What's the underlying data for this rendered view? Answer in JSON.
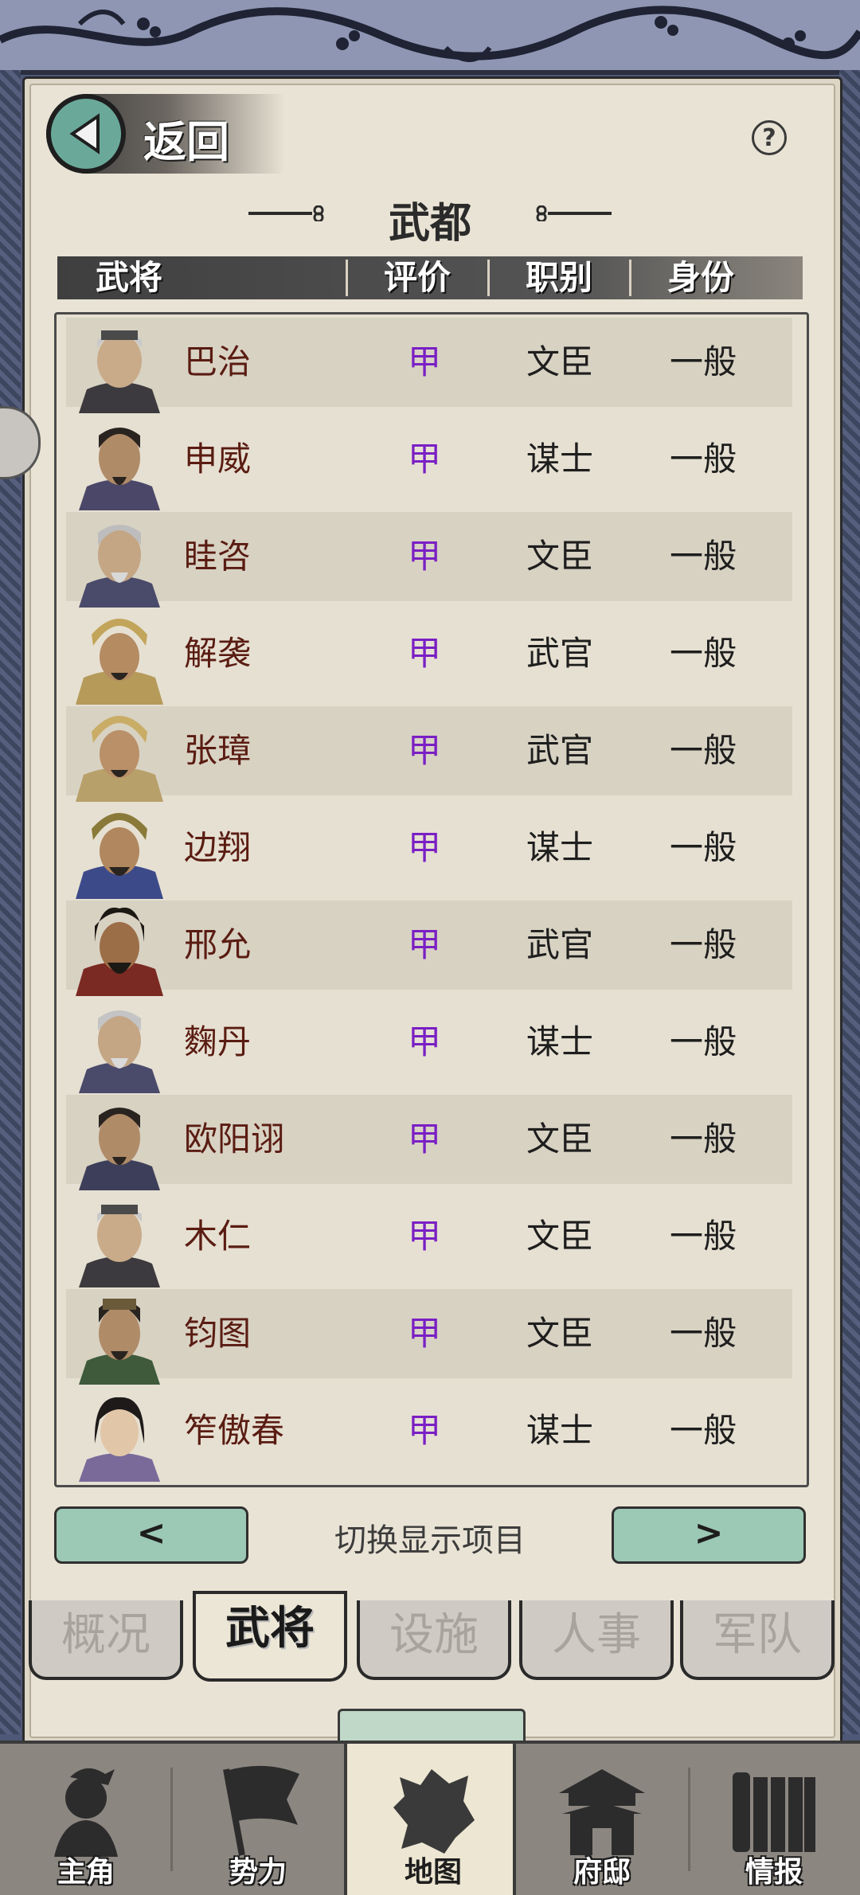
{
  "header": {
    "back_label": "返回",
    "help_symbol": "?",
    "city_name": "武都"
  },
  "columns": {
    "general": "武将",
    "rating": "评价",
    "post": "职别",
    "status": "身份"
  },
  "generals": [
    {
      "name": "巴治",
      "rating": "甲",
      "post": "文臣",
      "status": "一般"
    },
    {
      "name": "申威",
      "rating": "甲",
      "post": "谋士",
      "status": "一般"
    },
    {
      "name": "眭咨",
      "rating": "甲",
      "post": "文臣",
      "status": "一般"
    },
    {
      "name": "解袭",
      "rating": "甲",
      "post": "武官",
      "status": "一般"
    },
    {
      "name": "张璋",
      "rating": "甲",
      "post": "武官",
      "status": "一般"
    },
    {
      "name": "边翔",
      "rating": "甲",
      "post": "谋士",
      "status": "一般"
    },
    {
      "name": "邢允",
      "rating": "甲",
      "post": "武官",
      "status": "一般"
    },
    {
      "name": "麴丹",
      "rating": "甲",
      "post": "谋士",
      "status": "一般"
    },
    {
      "name": "欧阳诩",
      "rating": "甲",
      "post": "文臣",
      "status": "一般"
    },
    {
      "name": "木仁",
      "rating": "甲",
      "post": "文臣",
      "status": "一般"
    },
    {
      "name": "钧图",
      "rating": "甲",
      "post": "文臣",
      "status": "一般"
    },
    {
      "name": "笮傲春",
      "rating": "甲",
      "post": "谋士",
      "status": "一般"
    }
  ],
  "pager": {
    "prev": "<",
    "next": ">",
    "label": "切换显示项目"
  },
  "tabs": [
    "概况",
    "武将",
    "设施",
    "人事",
    "军队"
  ],
  "active_tab": "武将",
  "bottom_nav": [
    "主角",
    "势力",
    "地图",
    "府邸",
    "情报"
  ],
  "active_nav": "地图",
  "colors": {
    "rating": "#7a1fc4",
    "name": "#5a1c12",
    "accent": "#9cc8b6"
  }
}
